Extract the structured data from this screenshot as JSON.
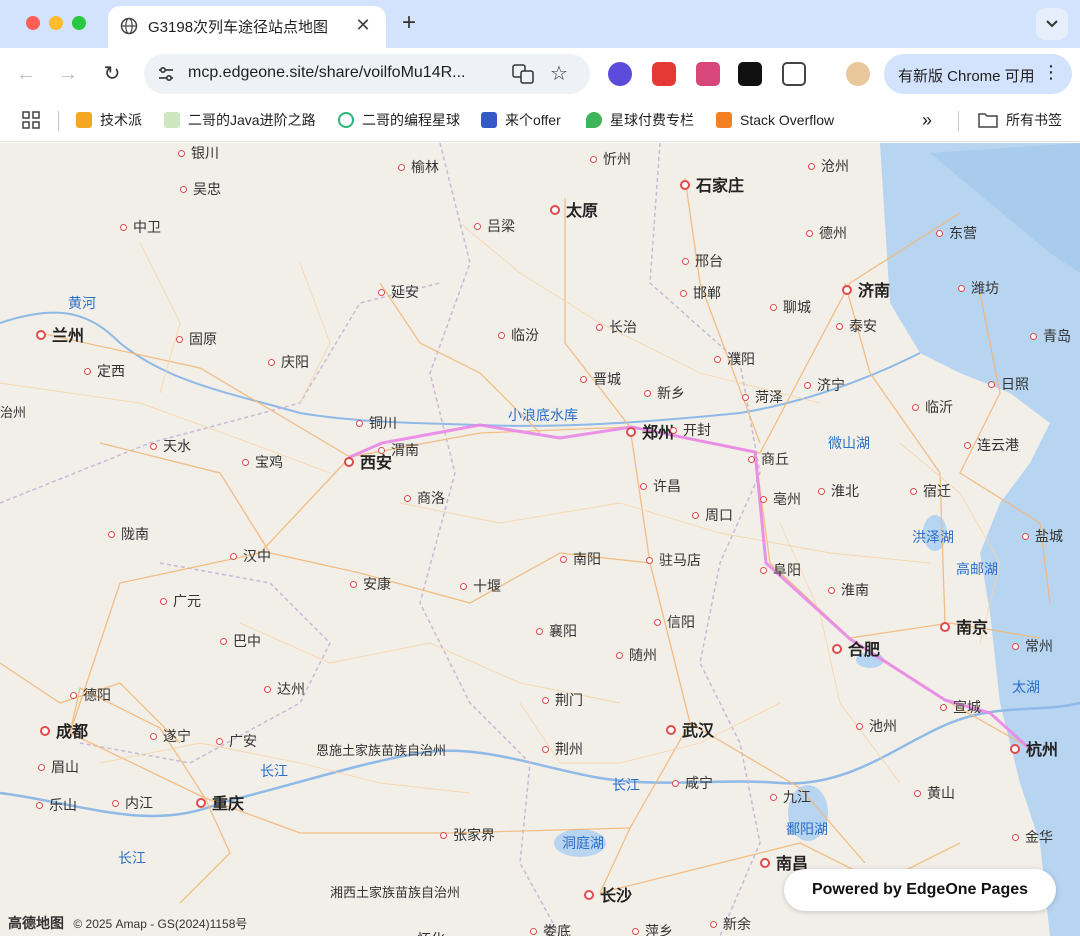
{
  "browser": {
    "tab_title": "G3198次列车途径站点地图",
    "url": "mcp.edgeone.site/share/voilfoMu14R...",
    "update_label": "有新版 Chrome 可用",
    "bookmarks": [
      "技术派",
      "二哥的Java进阶之路",
      "二哥的编程星球",
      "来个offer",
      "星球付费专栏",
      "Stack Overflow"
    ],
    "bookmarks_more": "»",
    "bookmarks_all": "所有书签",
    "icons": [
      "globe-icon",
      "close-icon",
      "plus-icon",
      "chevron-down-icon",
      "back-icon",
      "forward-icon",
      "reload-icon",
      "tune-icon",
      "translate-icon",
      "star-icon",
      "apps-grid-icon",
      "folder-icon",
      "kebab-menu-icon"
    ]
  },
  "map": {
    "route_color": "#e887e8",
    "route_stations": [
      "西安",
      "渭南",
      "郑州",
      "商丘",
      "阜阳",
      "合肥",
      "宣城",
      "杭州"
    ],
    "cities_major": [
      "太原",
      "石家庄",
      "济南",
      "郑州",
      "西安",
      "成都",
      "重庆",
      "武汉",
      "合肥",
      "南京",
      "杭州",
      "兰州",
      "南昌",
      "长沙"
    ],
    "cities": [
      "银川",
      "忻州",
      "沧州",
      "榆林",
      "吴忠",
      "中卫",
      "吕梁",
      "德州",
      "东营",
      "邢台",
      "邯郸",
      "聊城",
      "潍坊",
      "延安",
      "临汾",
      "长治",
      "泰安",
      "青岛",
      "固原",
      "庆阳",
      "濮阳",
      "定西",
      "晋城",
      "新乡",
      "菏泽",
      "济宁",
      "日照",
      "铜川",
      "临沂",
      "开封",
      "渭南",
      "天水",
      "宝鸡",
      "商丘",
      "连云港",
      "商洛",
      "许昌",
      "淮北",
      "宿迁",
      "亳州",
      "周口",
      "陇南",
      "汉中",
      "南阳",
      "驻马店",
      "盐城",
      "阜阳",
      "安康",
      "十堰",
      "淮南",
      "广元",
      "信阳",
      "襄阳",
      "巴中",
      "随州",
      "常州",
      "德阳",
      "达州",
      "荆门",
      "宣城",
      "遂宁",
      "广安",
      "池州",
      "眉山",
      "荆州",
      "咸宁",
      "黄山",
      "乐山",
      "内江",
      "九江",
      "张家界",
      "金华",
      "新余",
      "萍乡",
      "娄底",
      "怀化"
    ],
    "water_labels": [
      "黄河",
      "小浪底水库",
      "微山湖",
      "洪泽湖",
      "高邮湖",
      "太湖",
      "长江",
      "长江",
      "洞庭湖",
      "鄱阳湖",
      "长江"
    ],
    "region_labels": [
      "恩施土家族苗族自治州",
      "湘西土家族苗族自治州",
      "治州"
    ],
    "attribution": "© 2025 Amap - GS(2024)1158号",
    "amap_brand": "高德地图",
    "powered_by": "Powered by EdgeOne Pages"
  }
}
